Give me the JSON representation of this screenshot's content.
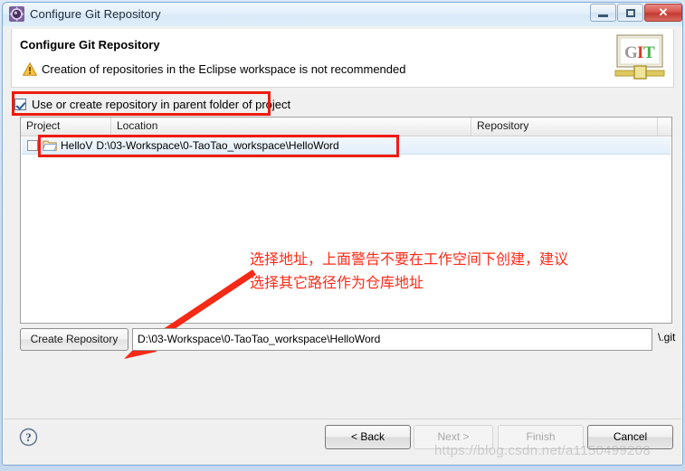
{
  "window": {
    "title": "Configure Git Repository",
    "icon": "eclipse-gear-icon",
    "controls": {
      "minimize": "minimize-icon",
      "restore": "restore-icon",
      "close": "✕"
    }
  },
  "header": {
    "title": "Configure Git Repository",
    "warning_icon": "warning-triangle-icon",
    "message": "Creation of repositories in the Eclipse workspace is not recommended",
    "logo": {
      "g": "G",
      "i": "I",
      "t": "T"
    }
  },
  "options": {
    "use_parent_folder_label": "Use or create repository in parent folder of project",
    "use_parent_folder_checked": true
  },
  "tree": {
    "columns": [
      "Project",
      "Location",
      "Repository"
    ],
    "rows": [
      {
        "checked": false,
        "icon": "open-folder-icon",
        "project": "HelloV",
        "location": "D:\\03-Workspace\\0-TaoTao_workspace\\HelloWord",
        "repository": ""
      }
    ]
  },
  "create_repository": {
    "button_label": "Create Repository",
    "path_value": "D:\\03-Workspace\\0-TaoTao_workspace\\HelloWord",
    "suffix": "\\.git"
  },
  "footer": {
    "help_icon": "help-question-icon",
    "buttons": [
      {
        "label": "< Back",
        "enabled": true
      },
      {
        "label": "Next >",
        "enabled": false
      },
      {
        "label": "Finish",
        "enabled": false
      },
      {
        "label": "Cancel",
        "enabled": true
      }
    ]
  },
  "annotations": {
    "color": "#ee1c10",
    "note_text": "选择地址，上面警告不要在工作空间下创建，建议\n选择其它路径作为仓库地址",
    "arrow": "red-arrow-down-left"
  },
  "watermark": "https://blog.csdn.net/a1150499208"
}
